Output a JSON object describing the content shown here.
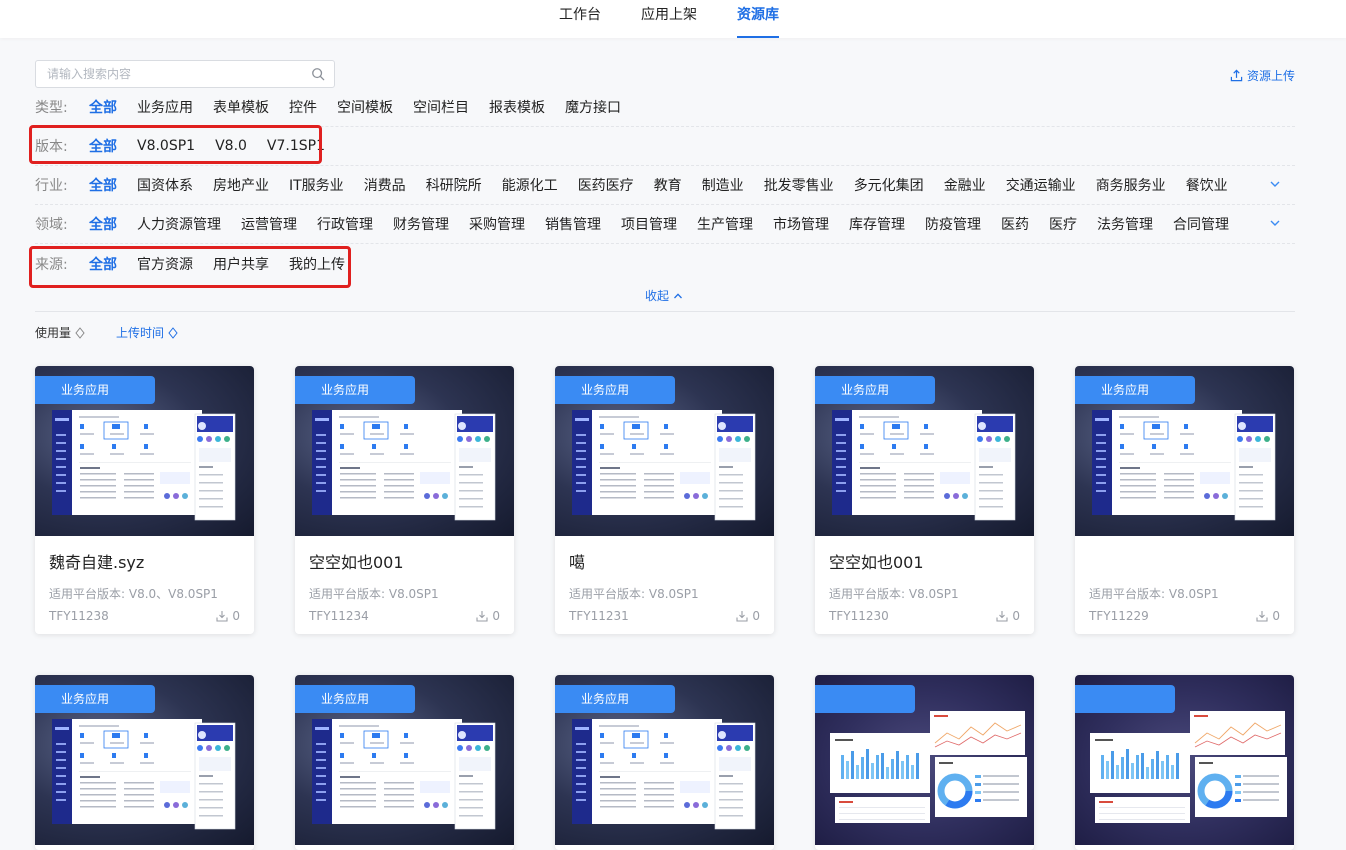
{
  "nav": {
    "tabs": [
      "工作台",
      "应用上架",
      "资源库"
    ],
    "active": 2
  },
  "search": {
    "placeholder": "请输入搜索内容",
    "value": ""
  },
  "upload_label": "资源上传",
  "filters": {
    "type": {
      "label": "类型:",
      "options": [
        "全部",
        "业务应用",
        "表单模板",
        "控件",
        "空间模板",
        "空间栏目",
        "报表模板",
        "魔方接口"
      ]
    },
    "version": {
      "label": "版本:",
      "options": [
        "全部",
        "V8.0SP1",
        "V8.0",
        "V7.1SP1"
      ]
    },
    "industry": {
      "label": "行业:",
      "options": [
        "全部",
        "国资体系",
        "房地产业",
        "IT服务业",
        "消费品",
        "科研院所",
        "能源化工",
        "医药医疗",
        "教育",
        "制造业",
        "批发零售业",
        "多元化集团",
        "金融业",
        "交通运输业",
        "商务服务业",
        "餐饮业"
      ]
    },
    "domain": {
      "label": "领域:",
      "options": [
        "全部",
        "人力资源管理",
        "运营管理",
        "行政管理",
        "财务管理",
        "采购管理",
        "销售管理",
        "项目管理",
        "生产管理",
        "市场管理",
        "库存管理",
        "防疫管理",
        "医药",
        "医疗",
        "法务管理",
        "合同管理"
      ]
    },
    "source": {
      "label": "来源:",
      "options": [
        "全部",
        "官方资源",
        "用户共享",
        "我的上传"
      ]
    }
  },
  "collapse_label": "收起",
  "sort": {
    "usage": "使用量",
    "upload_time": "上传时间"
  },
  "cards": [
    {
      "badge": "业务应用",
      "title": "魏奇自建.syz",
      "version": "适用平台版本: V8.0、V8.0SP1",
      "code": "TFY11238",
      "downloads": "0"
    },
    {
      "badge": "业务应用",
      "title": "空空如也001",
      "version": "适用平台版本: V8.0SP1",
      "code": "TFY11234",
      "downloads": "0"
    },
    {
      "badge": "业务应用",
      "title": "噶",
      "version": "适用平台版本: V8.0SP1",
      "code": "TFY11231",
      "downloads": "0"
    },
    {
      "badge": "业务应用",
      "title": "空空如也001",
      "version": "适用平台版本: V8.0SP1",
      "code": "TFY11230",
      "downloads": "0"
    },
    {
      "badge": "业务应用",
      "title": "",
      "version": "适用平台版本: V8.0SP1",
      "code": "TFY11229",
      "downloads": "0"
    },
    {
      "badge": "业务应用"
    },
    {
      "badge": "业务应用"
    },
    {
      "badge": "业务应用"
    },
    {
      "badge": ""
    },
    {
      "badge": ""
    }
  ],
  "colors": {
    "accent": "#1f6fe5",
    "badge": "#3a8bf3",
    "highlight_box": "#e0201f"
  }
}
